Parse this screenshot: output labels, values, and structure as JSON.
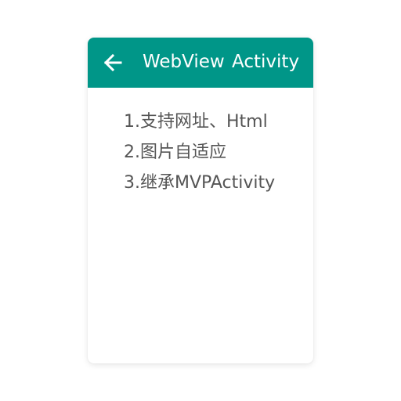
{
  "app": {
    "title": "WebView  Activity",
    "toolbar_color": "#009688",
    "back_icon": "arrow-left-icon"
  },
  "content": {
    "lines": [
      "1.支持网址、Html",
      "2.图片自适应",
      "3.继承MVPActivity"
    ]
  }
}
